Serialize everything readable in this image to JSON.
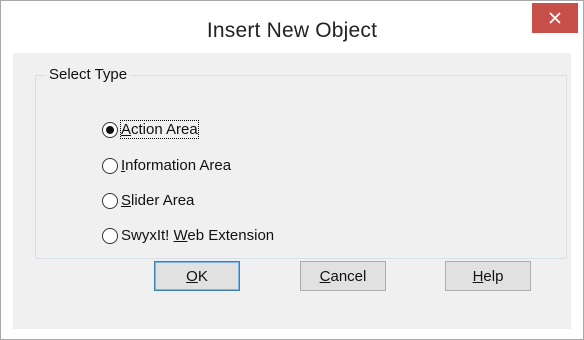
{
  "dialog": {
    "title": "Insert New Object"
  },
  "group": {
    "title": "Select Type",
    "options": [
      {
        "label": "Action Area",
        "accel": "A",
        "rest": "ction Area",
        "selected": true
      },
      {
        "label": "Information Area",
        "accel": "I",
        "rest": "nformation Area",
        "selected": false
      },
      {
        "label": "Slider Area",
        "accel": "S",
        "rest": "lider Area",
        "selected": false
      },
      {
        "label": "SwyxIt! Web Extension",
        "pre": "SwyxIt! ",
        "accel": "W",
        "rest": "eb Extension",
        "selected": false
      }
    ]
  },
  "buttons": {
    "ok": {
      "accel": "O",
      "rest": "K"
    },
    "cancel": {
      "accel": "C",
      "rest": "ancel"
    },
    "help": {
      "accel": "H",
      "rest": "elp"
    }
  },
  "icons": {
    "close": "close-icon"
  },
  "colors": {
    "close_button": "#c7504a",
    "client_background": "#f0f0f0",
    "default_button_border": "#3c7fb1"
  }
}
